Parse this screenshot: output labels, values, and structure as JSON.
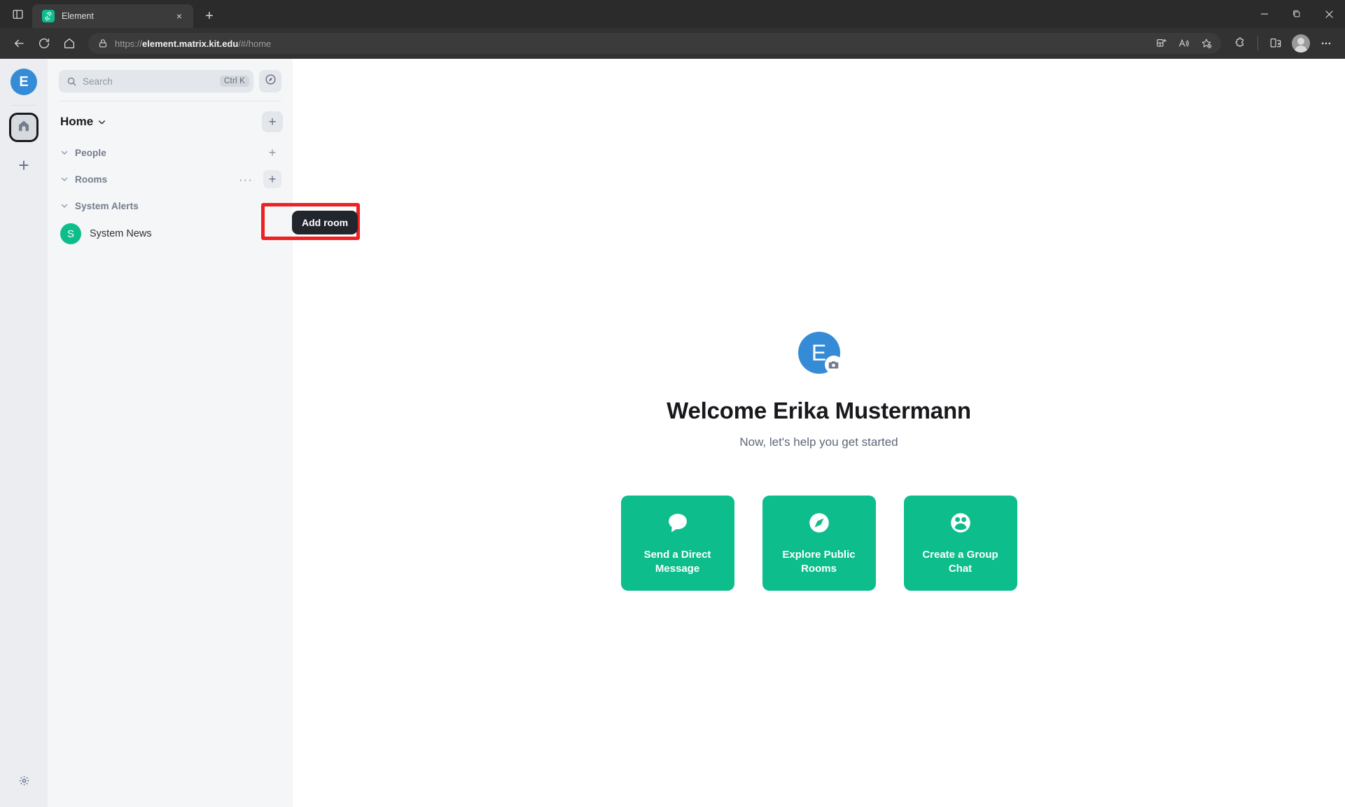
{
  "browser": {
    "tab": {
      "title": "Element",
      "favicon": "element-logo-icon",
      "close_label": "×"
    },
    "newtab_label": "+",
    "url": {
      "scheme": "https://",
      "host": "element.matrix.kit.edu",
      "path": "/#/home"
    },
    "window_controls": {
      "minimize": "–",
      "restore": "restore-icon",
      "close": "×"
    },
    "toolbar_icons": [
      "collections-icon",
      "read-aloud-icon",
      "add-favorite-icon",
      "extensions-icon",
      "split-screen-icon",
      "profile-avatar-icon",
      "settings-more-icon"
    ],
    "nav_icons": [
      "back-icon",
      "refresh-icon",
      "home-icon"
    ]
  },
  "spaces": {
    "user_avatar_letter": "E",
    "home_label": "Home",
    "add_space_label": "+",
    "settings_label": "Settings"
  },
  "search": {
    "placeholder": "Search",
    "shortcut": "Ctrl K"
  },
  "roomlist": {
    "title": "Home",
    "add_button_label": "+",
    "sections": [
      {
        "name": "people",
        "label": "People",
        "plus": "+",
        "has_dots": false,
        "plus_filled": false
      },
      {
        "name": "rooms",
        "label": "Rooms",
        "plus": "+",
        "has_dots": true,
        "dots": "···",
        "plus_filled": true
      },
      {
        "name": "system-alerts",
        "label": "System Alerts",
        "plus": "",
        "has_dots": false,
        "plus_filled": false
      }
    ],
    "rooms": [
      {
        "avatar_letter": "S",
        "name": "System News",
        "avatar_color": "#0dbd8b"
      }
    ]
  },
  "tooltip": {
    "text": "Add room"
  },
  "welcome": {
    "avatar_letter": "E",
    "title": "Welcome Erika Mustermann",
    "subtitle": "Now, let's help you get started",
    "cards": [
      {
        "icon": "chat-bubble-icon",
        "label": "Send a Direct Message"
      },
      {
        "icon": "compass-icon",
        "label": "Explore Public Rooms"
      },
      {
        "icon": "group-people-icon",
        "label": "Create a Group Chat"
      }
    ]
  },
  "colors": {
    "accent_green": "#0dbd8b",
    "avatar_blue": "#368bd6",
    "highlight_red": "#ee2225",
    "tooltip_bg": "#21262c"
  }
}
